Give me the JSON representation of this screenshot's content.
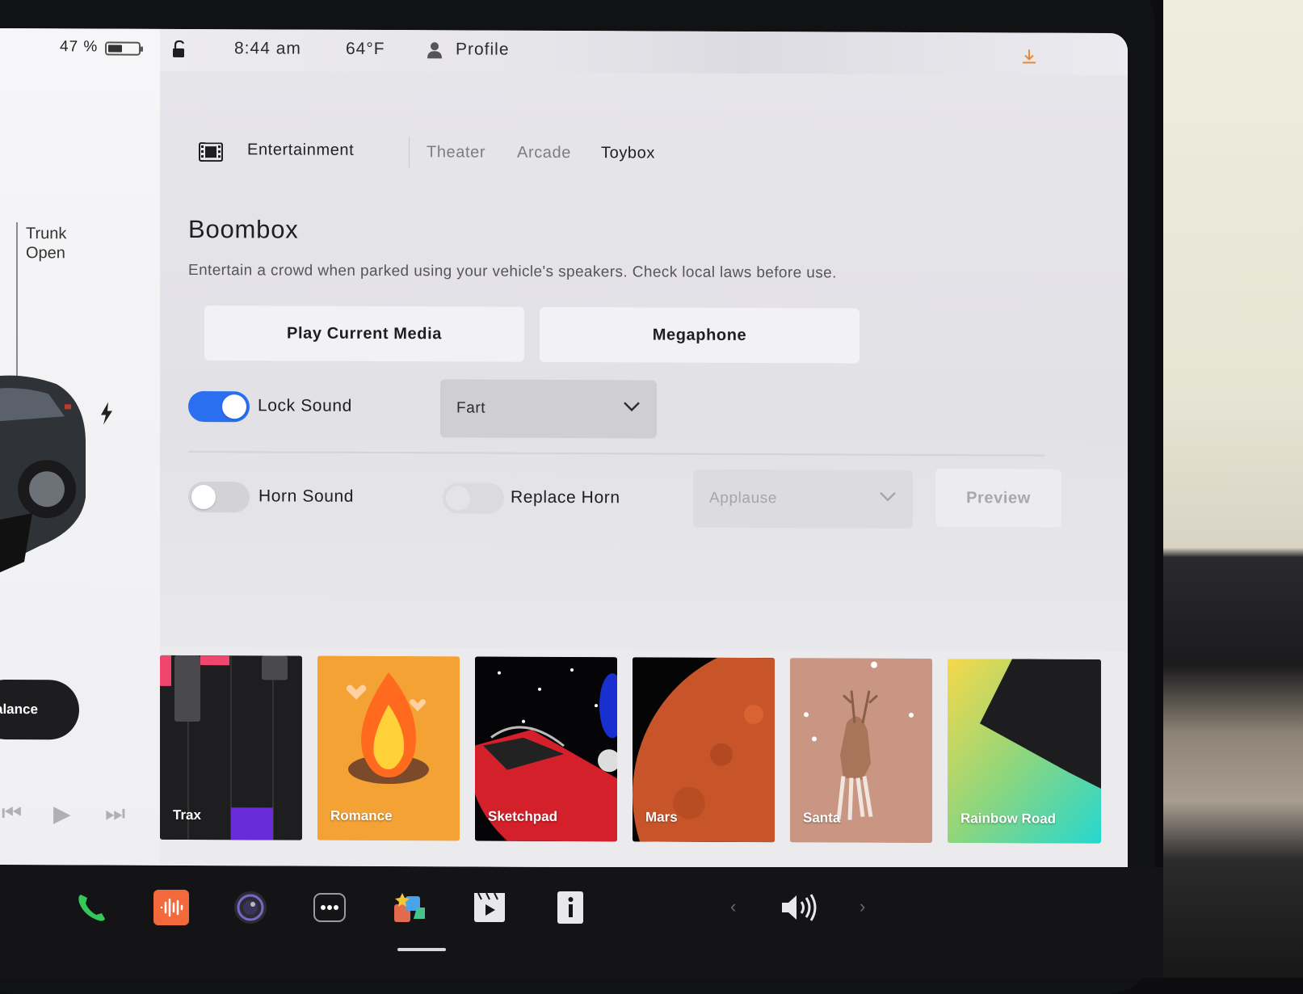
{
  "status": {
    "battery_percent": "47 %",
    "battery_level": 0.47,
    "time": "8:44 am",
    "temperature": "64°F",
    "profile": "Profile"
  },
  "car_panel": {
    "trunk_status": "Trunk\nOpen",
    "action_button": "alance"
  },
  "nav": {
    "category": "Entertainment",
    "tabs": [
      "Theater",
      "Arcade",
      "Toybox"
    ],
    "active_tab": "Toybox"
  },
  "boombox": {
    "title": "Boombox",
    "description": "Entertain a crowd when parked using your vehicle's speakers. Check local laws before use.",
    "play_media_label": "Play Current Media",
    "megaphone_label": "Megaphone",
    "lock_sound": {
      "label": "Lock Sound",
      "enabled": true,
      "selected": "Fart"
    },
    "horn_sound": {
      "label": "Horn Sound",
      "enabled": false
    },
    "replace_horn": {
      "label": "Replace Horn",
      "enabled": false,
      "selected": "Applause"
    },
    "preview_label": "Preview"
  },
  "tiles": [
    "Trax",
    "Romance",
    "Sketchpad",
    "Mars",
    "Santa",
    "Rainbow Road"
  ],
  "dock": {
    "icons": [
      "phone-icon",
      "audio-icon",
      "camera-icon",
      "more-icon",
      "toybox-icon",
      "theater-icon",
      "manual-icon",
      "volume-icon"
    ],
    "active": "toybox-icon"
  },
  "colors": {
    "accent": "#2a6ff0",
    "toggle_off": "#d3d3d7",
    "dock_bg": "#141416",
    "phone_green": "#34c759",
    "audio_orange": "#f26a3c"
  }
}
